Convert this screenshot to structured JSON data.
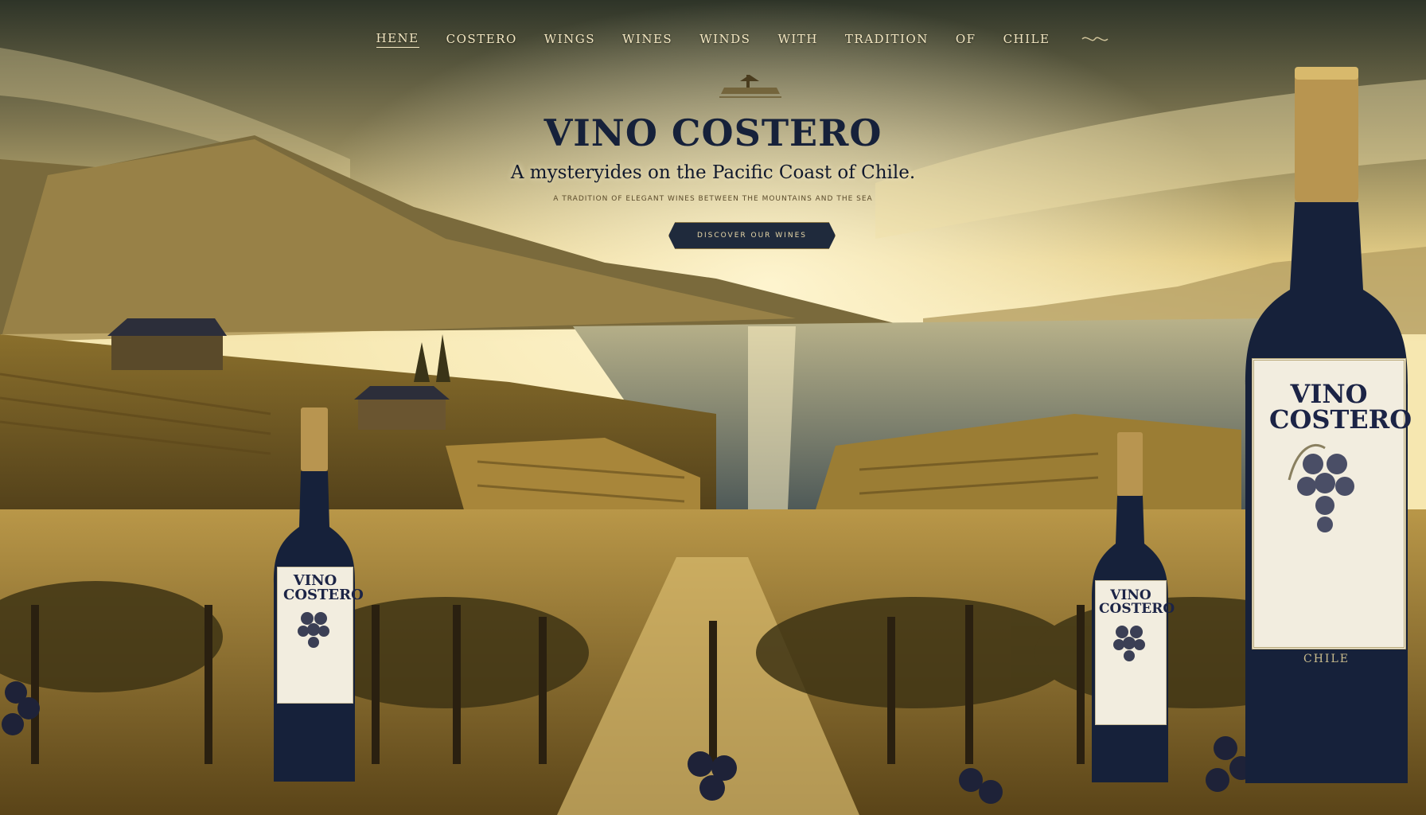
{
  "nav": {
    "items": [
      {
        "label": "HENE"
      },
      {
        "label": "COSTERO"
      },
      {
        "label": "WINGS"
      },
      {
        "label": "WINES"
      },
      {
        "label": "WINDS"
      },
      {
        "label": "WITH"
      },
      {
        "label": "TRADITION"
      },
      {
        "label": "OF"
      },
      {
        "label": "CHILE"
      }
    ],
    "icon": "decorative-scroll-icon"
  },
  "hero": {
    "title": "VINO COSTERO",
    "subtitle": "A mysteryides on the Pacific Coast of Chile.",
    "fine_print": "A TRADITION OF ELEGANT WINES BETWEEN THE MOUNTAINS AND THE SEA",
    "cta_label": "DISCOVER OUR WINES"
  },
  "bottles": {
    "left_label": "VINO COSTERO",
    "middle_label": "VINO COSTERO",
    "right_label": "VINO COSTERO",
    "right_origin": "CHILE"
  },
  "colors": {
    "sky_gold": "#d9b86a",
    "navy": "#16213a",
    "cream": "#f2eddf"
  }
}
